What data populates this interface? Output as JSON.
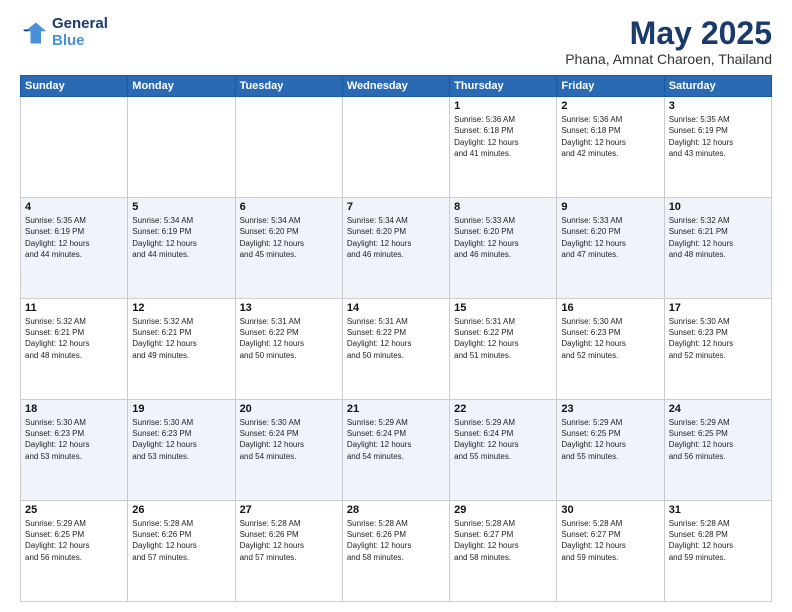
{
  "header": {
    "logo_line1": "General",
    "logo_line2": "Blue",
    "title": "May 2025",
    "subtitle": "Phana, Amnat Charoen, Thailand"
  },
  "weekdays": [
    "Sunday",
    "Monday",
    "Tuesday",
    "Wednesday",
    "Thursday",
    "Friday",
    "Saturday"
  ],
  "weeks": [
    [
      {
        "day": "",
        "info": ""
      },
      {
        "day": "",
        "info": ""
      },
      {
        "day": "",
        "info": ""
      },
      {
        "day": "",
        "info": ""
      },
      {
        "day": "1",
        "info": "Sunrise: 5:36 AM\nSunset: 6:18 PM\nDaylight: 12 hours\nand 41 minutes."
      },
      {
        "day": "2",
        "info": "Sunrise: 5:36 AM\nSunset: 6:18 PM\nDaylight: 12 hours\nand 42 minutes."
      },
      {
        "day": "3",
        "info": "Sunrise: 5:35 AM\nSunset: 6:19 PM\nDaylight: 12 hours\nand 43 minutes."
      }
    ],
    [
      {
        "day": "4",
        "info": "Sunrise: 5:35 AM\nSunset: 6:19 PM\nDaylight: 12 hours\nand 44 minutes."
      },
      {
        "day": "5",
        "info": "Sunrise: 5:34 AM\nSunset: 6:19 PM\nDaylight: 12 hours\nand 44 minutes."
      },
      {
        "day": "6",
        "info": "Sunrise: 5:34 AM\nSunset: 6:20 PM\nDaylight: 12 hours\nand 45 minutes."
      },
      {
        "day": "7",
        "info": "Sunrise: 5:34 AM\nSunset: 6:20 PM\nDaylight: 12 hours\nand 46 minutes."
      },
      {
        "day": "8",
        "info": "Sunrise: 5:33 AM\nSunset: 6:20 PM\nDaylight: 12 hours\nand 46 minutes."
      },
      {
        "day": "9",
        "info": "Sunrise: 5:33 AM\nSunset: 6:20 PM\nDaylight: 12 hours\nand 47 minutes."
      },
      {
        "day": "10",
        "info": "Sunrise: 5:32 AM\nSunset: 6:21 PM\nDaylight: 12 hours\nand 48 minutes."
      }
    ],
    [
      {
        "day": "11",
        "info": "Sunrise: 5:32 AM\nSunset: 6:21 PM\nDaylight: 12 hours\nand 48 minutes."
      },
      {
        "day": "12",
        "info": "Sunrise: 5:32 AM\nSunset: 6:21 PM\nDaylight: 12 hours\nand 49 minutes."
      },
      {
        "day": "13",
        "info": "Sunrise: 5:31 AM\nSunset: 6:22 PM\nDaylight: 12 hours\nand 50 minutes."
      },
      {
        "day": "14",
        "info": "Sunrise: 5:31 AM\nSunset: 6:22 PM\nDaylight: 12 hours\nand 50 minutes."
      },
      {
        "day": "15",
        "info": "Sunrise: 5:31 AM\nSunset: 6:22 PM\nDaylight: 12 hours\nand 51 minutes."
      },
      {
        "day": "16",
        "info": "Sunrise: 5:30 AM\nSunset: 6:23 PM\nDaylight: 12 hours\nand 52 minutes."
      },
      {
        "day": "17",
        "info": "Sunrise: 5:30 AM\nSunset: 6:23 PM\nDaylight: 12 hours\nand 52 minutes."
      }
    ],
    [
      {
        "day": "18",
        "info": "Sunrise: 5:30 AM\nSunset: 6:23 PM\nDaylight: 12 hours\nand 53 minutes."
      },
      {
        "day": "19",
        "info": "Sunrise: 5:30 AM\nSunset: 6:23 PM\nDaylight: 12 hours\nand 53 minutes."
      },
      {
        "day": "20",
        "info": "Sunrise: 5:30 AM\nSunset: 6:24 PM\nDaylight: 12 hours\nand 54 minutes."
      },
      {
        "day": "21",
        "info": "Sunrise: 5:29 AM\nSunset: 6:24 PM\nDaylight: 12 hours\nand 54 minutes."
      },
      {
        "day": "22",
        "info": "Sunrise: 5:29 AM\nSunset: 6:24 PM\nDaylight: 12 hours\nand 55 minutes."
      },
      {
        "day": "23",
        "info": "Sunrise: 5:29 AM\nSunset: 6:25 PM\nDaylight: 12 hours\nand 55 minutes."
      },
      {
        "day": "24",
        "info": "Sunrise: 5:29 AM\nSunset: 6:25 PM\nDaylight: 12 hours\nand 56 minutes."
      }
    ],
    [
      {
        "day": "25",
        "info": "Sunrise: 5:29 AM\nSunset: 6:25 PM\nDaylight: 12 hours\nand 56 minutes."
      },
      {
        "day": "26",
        "info": "Sunrise: 5:28 AM\nSunset: 6:26 PM\nDaylight: 12 hours\nand 57 minutes."
      },
      {
        "day": "27",
        "info": "Sunrise: 5:28 AM\nSunset: 6:26 PM\nDaylight: 12 hours\nand 57 minutes."
      },
      {
        "day": "28",
        "info": "Sunrise: 5:28 AM\nSunset: 6:26 PM\nDaylight: 12 hours\nand 58 minutes."
      },
      {
        "day": "29",
        "info": "Sunrise: 5:28 AM\nSunset: 6:27 PM\nDaylight: 12 hours\nand 58 minutes."
      },
      {
        "day": "30",
        "info": "Sunrise: 5:28 AM\nSunset: 6:27 PM\nDaylight: 12 hours\nand 59 minutes."
      },
      {
        "day": "31",
        "info": "Sunrise: 5:28 AM\nSunset: 6:28 PM\nDaylight: 12 hours\nand 59 minutes."
      }
    ]
  ]
}
